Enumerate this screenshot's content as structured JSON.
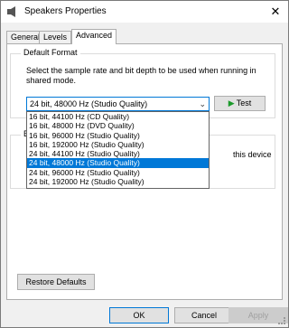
{
  "window": {
    "title": "Speakers Properties",
    "close_glyph": "✕"
  },
  "tabs": [
    {
      "label": "General"
    },
    {
      "label": "Levels"
    },
    {
      "label": "Advanced",
      "active": true
    }
  ],
  "default_format": {
    "group_title": "Default Format",
    "description": "Select the sample rate and bit depth to be used when running in shared mode.",
    "selected_value": "24 bit, 48000 Hz (Studio Quality)",
    "test_label": "Test",
    "options": [
      "16 bit, 44100 Hz (CD Quality)",
      "16 bit, 48000 Hz (DVD Quality)",
      "16 bit, 96000 Hz (Studio Quality)",
      "16 bit, 192000 Hz (Studio Quality)",
      "24 bit, 44100 Hz (Studio Quality)",
      "24 bit, 48000 Hz (Studio Quality)",
      "24 bit, 96000 Hz (Studio Quality)",
      "24 bit, 192000 Hz (Studio Quality)"
    ],
    "highlighted_index": 5
  },
  "background_group": {
    "title_partial": "E",
    "visible_text": "this device"
  },
  "buttons": {
    "restore_defaults": "Restore Defaults",
    "ok": "OK",
    "cancel": "Cancel",
    "apply": "Apply"
  },
  "colors": {
    "accent": "#0078d7",
    "test_play_icon": "#1a9a2a"
  }
}
